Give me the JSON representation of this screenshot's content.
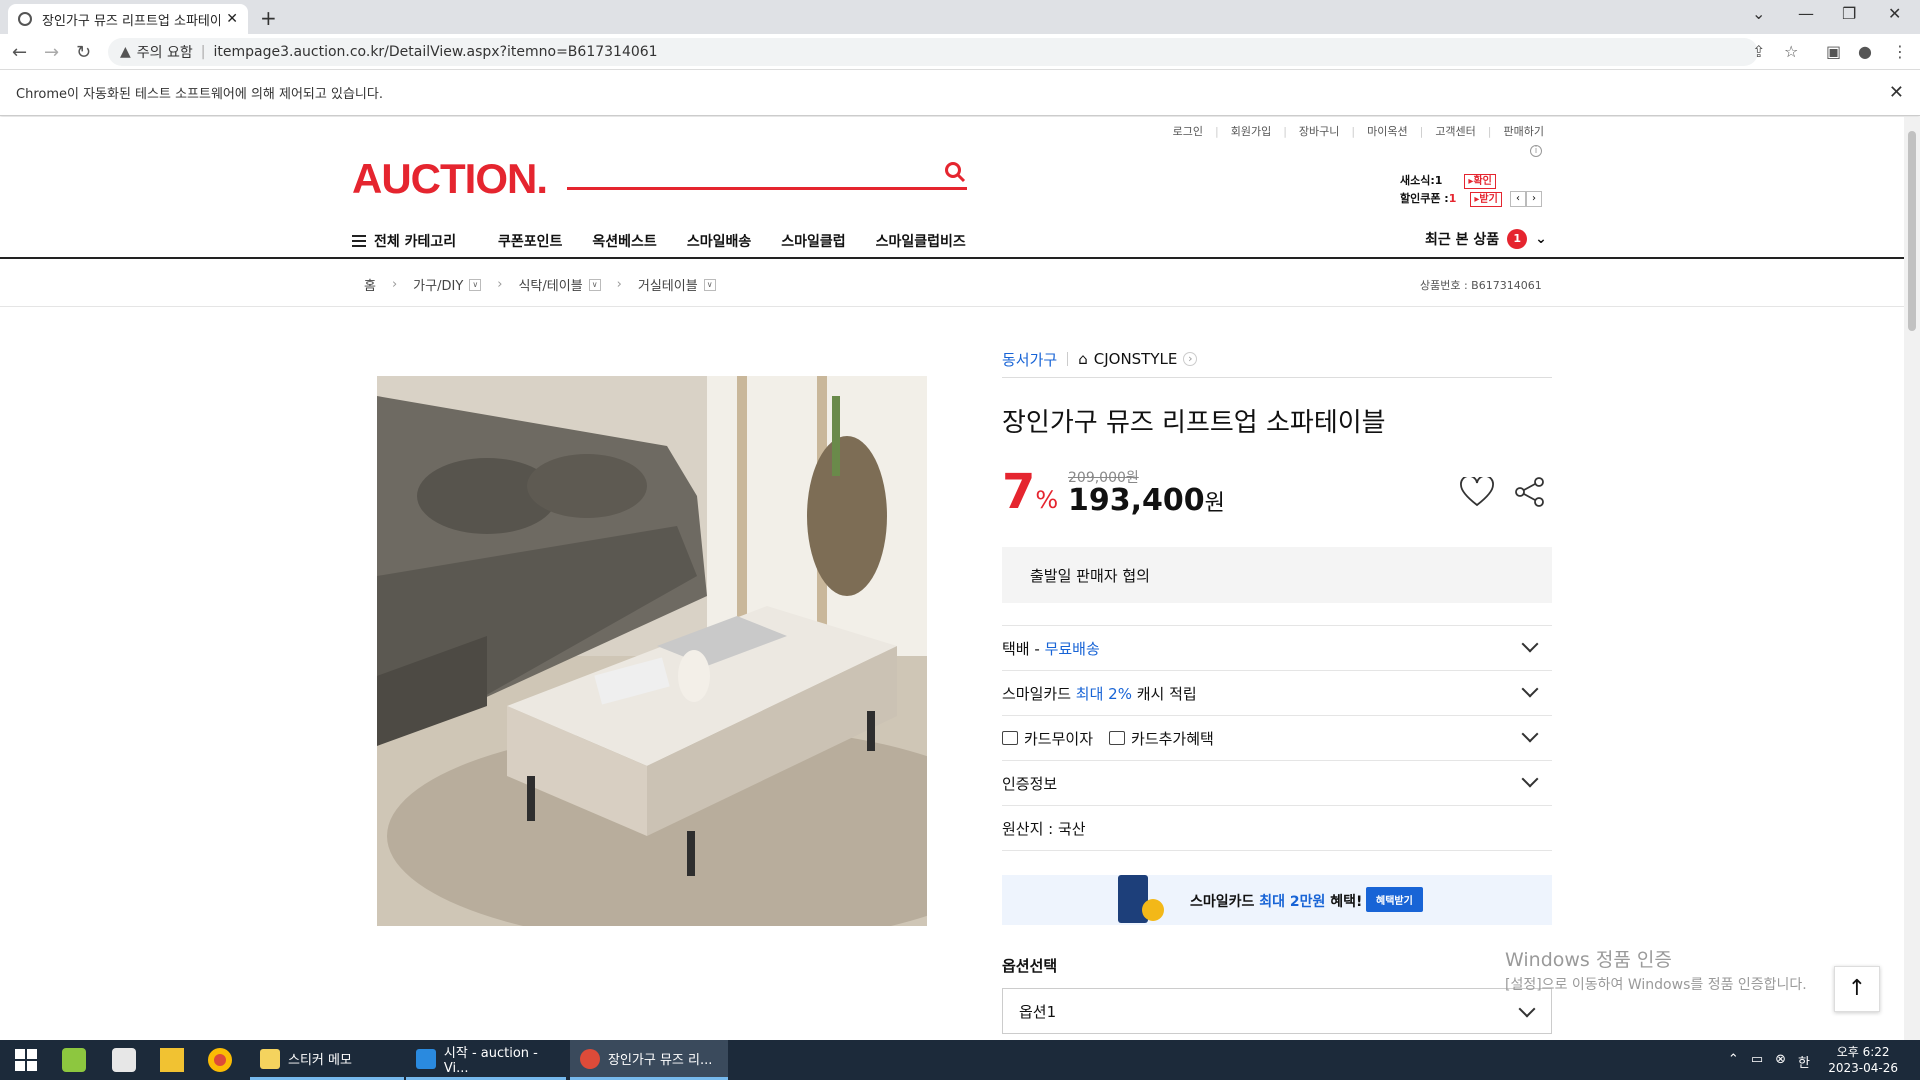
{
  "browser": {
    "tab_title": "장인가구 뮤즈 리프트업 소파테이블",
    "address_warning": "주의 요함",
    "url": "itempage3.auction.co.kr/DetailView.aspx?itemno=B617314061",
    "automation_notice": "Chrome이 자동화된 테스트 소프트웨어에 의해 제어되고 있습니다."
  },
  "header": {
    "top_links": [
      "로그인",
      "회원가입",
      "장바구니",
      "마이옥션",
      "고객센터",
      "판매하기"
    ],
    "logo": "AUCTION.",
    "new_message_label": "새소식:",
    "new_message_count": "1",
    "new_message_btn": "확인",
    "coupon_label": "할인쿠폰 :",
    "coupon_count": "1",
    "coupon_btn": "받기"
  },
  "gnb": {
    "all_category": "전체 카테고리",
    "menu": [
      "쿠폰포인트",
      "옥션베스트",
      "스마일배송",
      "스마일클럽",
      "스마일클럽비즈"
    ],
    "recent_label": "최근 본 상품",
    "recent_count": "1"
  },
  "breadcrumb": {
    "home": "홈",
    "items": [
      "가구/DIY",
      "식탁/테이블",
      "거실테이블"
    ],
    "product_code": "상품번호 : B617314061"
  },
  "product": {
    "seller": "동서가구",
    "store": "CJONSTYLE",
    "title": "장인가구 뮤즈 리프트업 소파테이블",
    "discount": "7",
    "discount_unit": "%",
    "original_price": "209,000원",
    "price": "193,400",
    "price_unit": "원",
    "ship_notice": "출발일 판매자 협의",
    "delivery_label": "택배 - ",
    "delivery_value": "무료배송",
    "smilecard_pre": "스마일카드 ",
    "smilecard_highlight": "최대 2%",
    "smilecard_post": " 캐시 적립",
    "card_installment": "카드무이자",
    "card_benefit": "카드추가혜택",
    "certification": "인증정보",
    "origin": "원산지 : 국산",
    "banner_pre": "스마일카드 ",
    "banner_highlight": "최대 2만원",
    "banner_post": " 혜택!",
    "banner_btn": "혜택받기",
    "option_label": "옵션선택",
    "option_value": "옵션1"
  },
  "watermark": {
    "line1": "Windows 정품 인증",
    "line2": "[설정]으로 이동하여 Windows를 정품 인증합니다."
  },
  "taskbar": {
    "apps": [
      "스티커 메모",
      "시작 - auction - Vi...",
      "장인가구 뮤즈 리..."
    ],
    "time": "오후 6:22",
    "date": "2023-04-26"
  }
}
